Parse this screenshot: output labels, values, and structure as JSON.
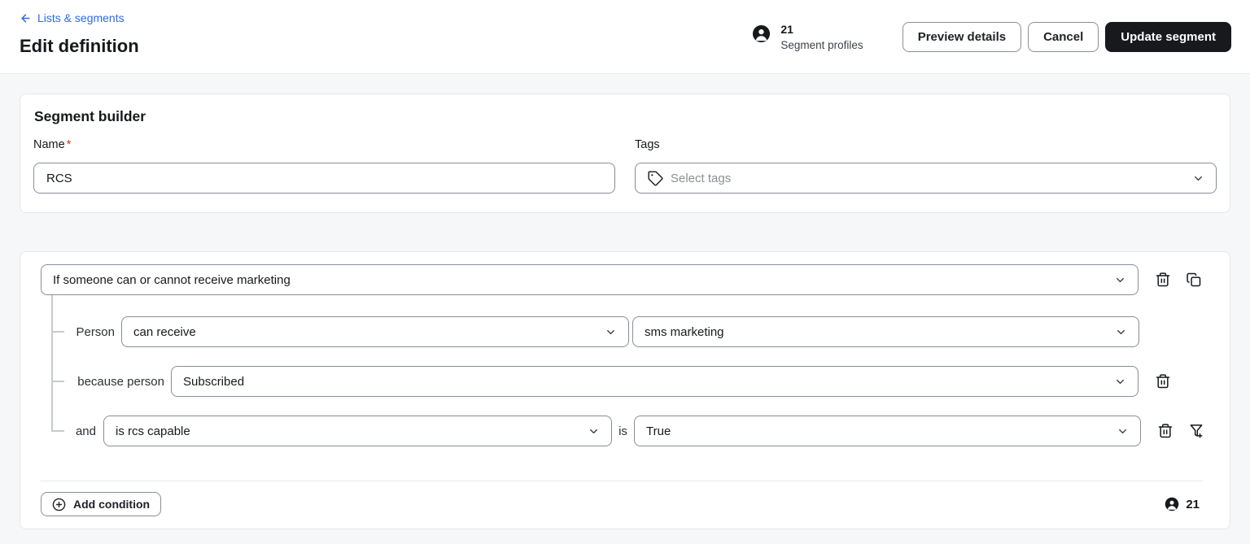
{
  "header": {
    "back_link_label": "Lists & segments",
    "title": "Edit definition",
    "profiles": {
      "count": "21",
      "label": "Segment profiles"
    },
    "preview_button": "Preview details",
    "cancel_button": "Cancel",
    "update_button": "Update segment"
  },
  "segment_builder": {
    "title": "Segment builder",
    "name_label": "Name",
    "required_marker": "*",
    "name_value": "RCS",
    "tags_label": "Tags",
    "tags_placeholder": "Select tags"
  },
  "conditions": {
    "type_select": "If someone can or cannot receive marketing",
    "row1_label": "Person",
    "row1_operator": "can receive",
    "row1_channel": "sms marketing",
    "row2_label": "because person",
    "row2_value": "Subscribed",
    "row3_label": "and",
    "row3_property": "is rcs capable",
    "row3_connector": "is",
    "row3_value": "True",
    "add_condition_label": "Add condition",
    "profiles_count": "21"
  },
  "colors": {
    "link_blue": "#2e6be5",
    "primary_button_bg": "#17191c",
    "required_red": "#d92d20",
    "page_bg": "#f6f7f8"
  }
}
